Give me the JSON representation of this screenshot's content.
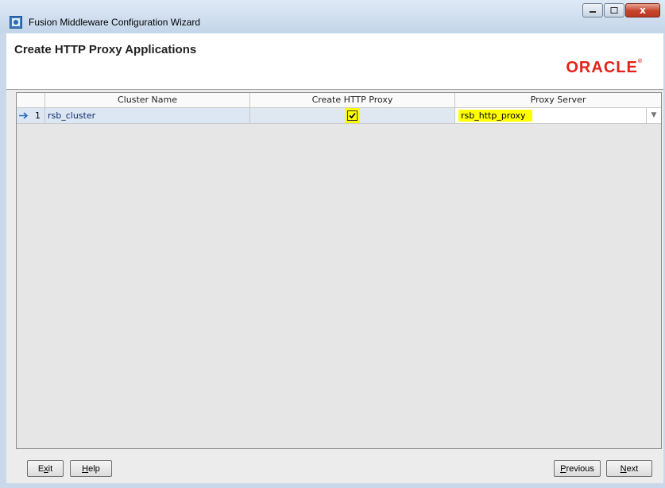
{
  "window": {
    "title": "Fusion Middleware Configuration Wizard",
    "close_glyph": "x"
  },
  "header": {
    "title": "Create HTTP Proxy Applications",
    "logo_text": "ORACLE"
  },
  "table": {
    "columns": [
      "Cluster Name",
      "Create HTTP Proxy",
      "Proxy Server"
    ],
    "rows": [
      {
        "index": "1",
        "cluster_name": "rsb_cluster",
        "create_http_proxy": true,
        "proxy_server": "rsb_http_proxy"
      }
    ]
  },
  "buttons": {
    "exit": {
      "pre": "E",
      "mnemonic": "x",
      "post": "it"
    },
    "help": {
      "pre": "",
      "mnemonic": "H",
      "post": "elp"
    },
    "previous": {
      "pre": "",
      "mnemonic": "P",
      "post": "revious"
    },
    "next": {
      "pre": "",
      "mnemonic": "N",
      "post": "ext"
    }
  },
  "icons": {
    "app": "wizard-app-icon",
    "row_arrow": "arrow-right-icon",
    "dropdown": "chevron-down-icon"
  },
  "colors": {
    "highlight": "#ffff00",
    "oracle_red": "#e2231a",
    "row_selected": "#dde7f3"
  }
}
